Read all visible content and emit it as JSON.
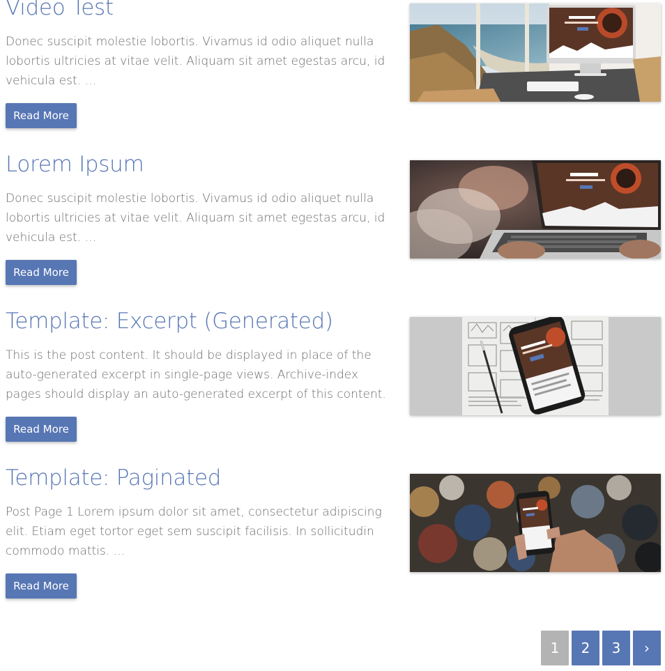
{
  "posts": [
    {
      "title": "Video Test",
      "excerpt": "Donec suscipit molestie lobortis. Vivamus id odio aliquet nulla lobortis ultricies at vitae velit. Aliquam sit amet egestas arcu, id vehicula est. …",
      "button": "Read More"
    },
    {
      "title": "Lorem Ipsum",
      "excerpt": "Donec suscipit molestie lobortis. Vivamus id odio aliquet nulla lobortis ultricies at vitae velit. Aliquam sit amet egestas arcu, id vehicula est. …",
      "button": "Read More"
    },
    {
      "title": "Template: Excerpt (Generated)",
      "excerpt": "This is the post content. It should be displayed in place of the auto-generated excerpt in single-page views. Archive-index pages should display an auto-generated excerpt of this content. …",
      "button": "Read More"
    },
    {
      "title": "Template: Paginated",
      "excerpt": "Post Page 1 Lorem ipsum dolor sit amet, consectetur adipiscing elit. Etiam eget tortor eget sem suscipit facilisis. In sollicitudin commodo mattis. …",
      "button": "Read More"
    }
  ],
  "pagination": {
    "pages": [
      "1",
      "2",
      "3"
    ],
    "next": "›",
    "current": "1"
  },
  "colors": {
    "accent": "#5776b4",
    "text": "#6b6b6b",
    "page_current": "#b3b3b3"
  }
}
